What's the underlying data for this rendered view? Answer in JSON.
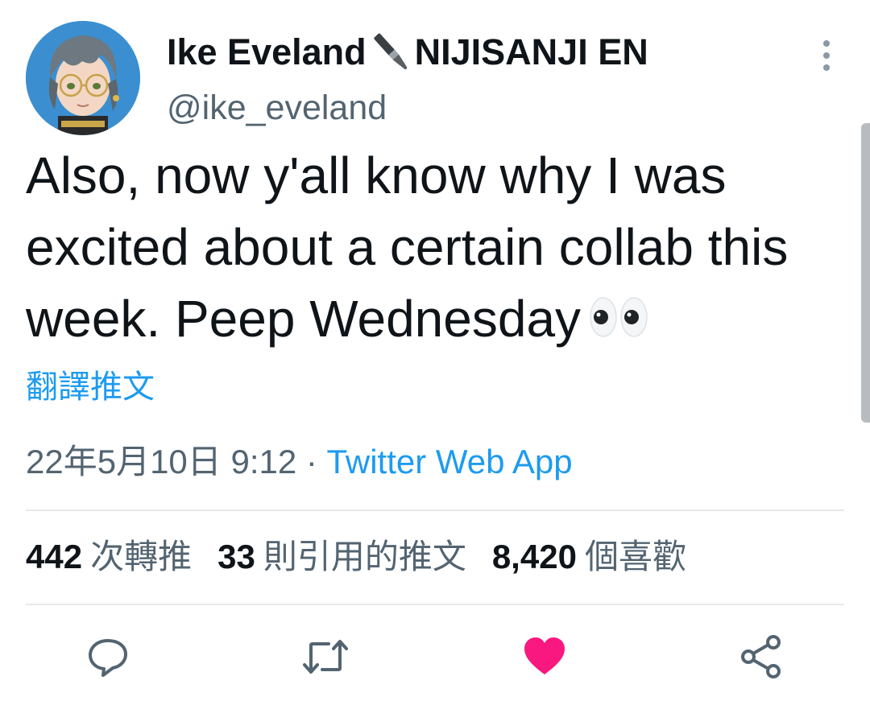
{
  "author": {
    "display_name": "Ike Eveland",
    "brand": "NIJISANJI EN",
    "handle": "@ike_eveland",
    "avatar_icon": "avatar",
    "name_icon": "paintbrush-icon"
  },
  "tweet": {
    "text": "Also, now y'all know why I was excited about a certain collab this week. Peep Wednesday",
    "emoji_icon": "eyes-icon",
    "translate_label": "翻譯推文",
    "timestamp": "22年5月10日 9:12",
    "separator": " · ",
    "source": "Twitter Web App"
  },
  "stats": {
    "retweets": {
      "count": "442",
      "label": "次轉推"
    },
    "quotes": {
      "count": "33",
      "label": "則引用的推文"
    },
    "likes": {
      "count": "8,420",
      "label": "個喜歡"
    }
  },
  "actions": {
    "reply_icon": "reply-icon",
    "retweet_icon": "retweet-icon",
    "like_icon": "heart-icon",
    "share_icon": "share-icon",
    "liked": true
  },
  "colors": {
    "accent": "#1d9bf0",
    "like": "#f91880",
    "text_primary": "#0f1419",
    "text_secondary": "#536471"
  }
}
